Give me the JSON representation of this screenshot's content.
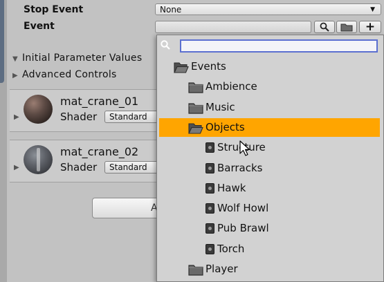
{
  "inspector": {
    "stop_event_label": "Stop Event",
    "stop_event_value": "None",
    "event_label": "Event",
    "foldouts": [
      "Initial Parameter Values",
      "Advanced Controls"
    ],
    "materials": [
      {
        "name": "mat_crane_01",
        "shader_label": "Shader",
        "shader_value": "Standard"
      },
      {
        "name": "mat_crane_02",
        "shader_label": "Shader",
        "shader_value": "Standard"
      }
    ],
    "add_button_text": "A"
  },
  "browser": {
    "search_value": "",
    "tree": [
      {
        "label": "Events",
        "kind": "folder",
        "depth": 0,
        "open": true,
        "selected": false
      },
      {
        "label": "Ambience",
        "kind": "folder",
        "depth": 1,
        "open": false,
        "selected": false
      },
      {
        "label": "Music",
        "kind": "folder",
        "depth": 1,
        "open": false,
        "selected": false
      },
      {
        "label": "Objects",
        "kind": "folder",
        "depth": 1,
        "open": true,
        "selected": true
      },
      {
        "label": "Structure",
        "kind": "event",
        "depth": 2,
        "selected": false
      },
      {
        "label": "Barracks",
        "kind": "event",
        "depth": 2,
        "selected": false
      },
      {
        "label": "Hawk",
        "kind": "event",
        "depth": 2,
        "selected": false
      },
      {
        "label": "Wolf Howl",
        "kind": "event",
        "depth": 2,
        "selected": false
      },
      {
        "label": "Pub Brawl",
        "kind": "event",
        "depth": 2,
        "selected": false
      },
      {
        "label": "Torch",
        "kind": "event",
        "depth": 2,
        "selected": false
      },
      {
        "label": "Player",
        "kind": "folder",
        "depth": 1,
        "open": false,
        "selected": false
      }
    ]
  },
  "colors": {
    "selection": "#ffa500",
    "search_border": "#5b6fd0"
  }
}
